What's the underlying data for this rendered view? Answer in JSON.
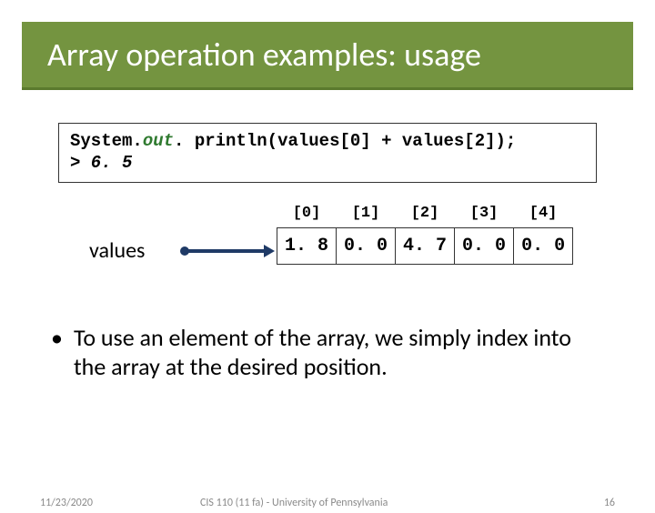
{
  "title": "Array operation examples: usage",
  "code": {
    "prefix": "System.",
    "out": "out",
    "suffix": ". println(values[0] + values[2]);",
    "result_line": "> 6. 5"
  },
  "variable_name": "values",
  "array": {
    "indices": [
      "[0]",
      "[1]",
      "[2]",
      "[3]",
      "[4]"
    ],
    "values": [
      "1. 8",
      "0. 0",
      "4. 7",
      "0. 0",
      "0. 0"
    ]
  },
  "bullet_text": "To use an element of the array, we simply index into the array at the desired position.",
  "footer": {
    "date": "11/23/2020",
    "mid": "CIS 110 (11 fa) - University of Pennsylvania",
    "page": "16"
  }
}
